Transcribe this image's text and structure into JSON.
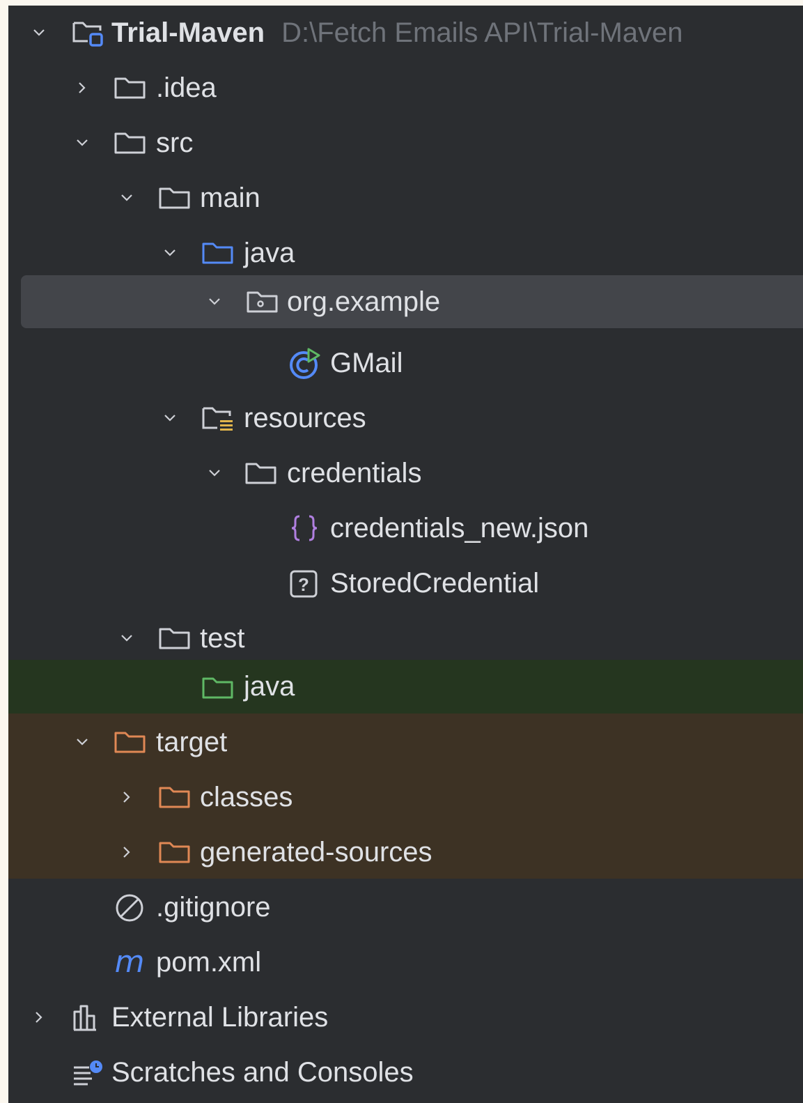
{
  "tree": {
    "project": {
      "name": "Trial-Maven",
      "path": "D:\\Fetch Emails API\\Trial-Maven"
    },
    "nodes": [
      {
        "label": ".idea"
      },
      {
        "label": "src"
      },
      {
        "label": "main"
      },
      {
        "label": "java"
      },
      {
        "label": "org.example"
      },
      {
        "label": "GMail"
      },
      {
        "label": "resources"
      },
      {
        "label": "credentials"
      },
      {
        "label": "credentials_new.json"
      },
      {
        "label": "StoredCredential"
      },
      {
        "label": "test"
      },
      {
        "label": "java"
      },
      {
        "label": "target"
      },
      {
        "label": "classes"
      },
      {
        "label": "generated-sources"
      },
      {
        "label": ".gitignore"
      },
      {
        "label": "pom.xml"
      }
    ],
    "external_libraries": "External Libraries",
    "scratches": "Scratches and Consoles"
  },
  "colors": {
    "panel": "#2b2d30",
    "selection": "#43454a",
    "test_source_bg": "#25361f",
    "excluded_bg": "#3d3224",
    "source_folder": "#548af7",
    "test_folder": "#5fb865",
    "excluded_folder": "#e08855",
    "json_icon": "#b07fe0",
    "maven_icon": "#548af7"
  }
}
